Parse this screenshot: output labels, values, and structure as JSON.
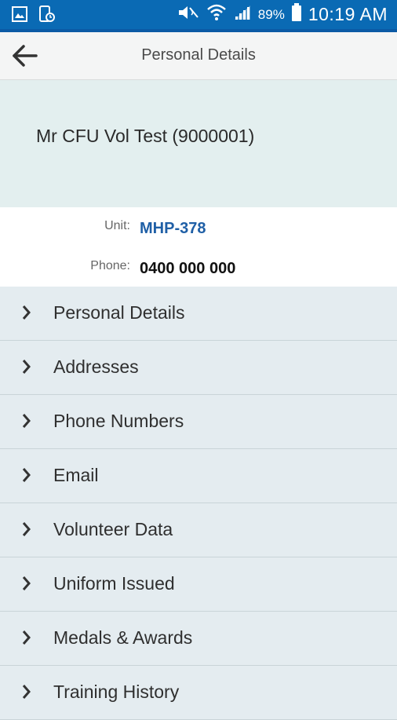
{
  "status_bar": {
    "icons_left": [
      "image-icon",
      "phone-sync-icon"
    ],
    "icons_right": [
      "mute-icon",
      "wifi-icon",
      "signal-icon",
      "battery-icon"
    ],
    "battery": "89%",
    "time": "10:19 AM",
    "bar_color": "#0a6ab4"
  },
  "header": {
    "title": "Personal Details",
    "back_icon": "arrow-left-icon"
  },
  "profile": {
    "name": "Mr CFU Vol Test (9000001)"
  },
  "info": {
    "unit_label": "Unit:",
    "unit_value": "MHP-378",
    "phone_label": "Phone:",
    "phone_value": "0400 000 000",
    "accent_color": "#1f5fa6"
  },
  "menu": {
    "chevron_icon": "chevron-right-icon",
    "items": [
      {
        "label": "Personal Details"
      },
      {
        "label": "Addresses"
      },
      {
        "label": "Phone Numbers"
      },
      {
        "label": "Email"
      },
      {
        "label": "Volunteer Data"
      },
      {
        "label": "Uniform Issued"
      },
      {
        "label": "Medals & Awards"
      },
      {
        "label": "Training History"
      }
    ]
  }
}
